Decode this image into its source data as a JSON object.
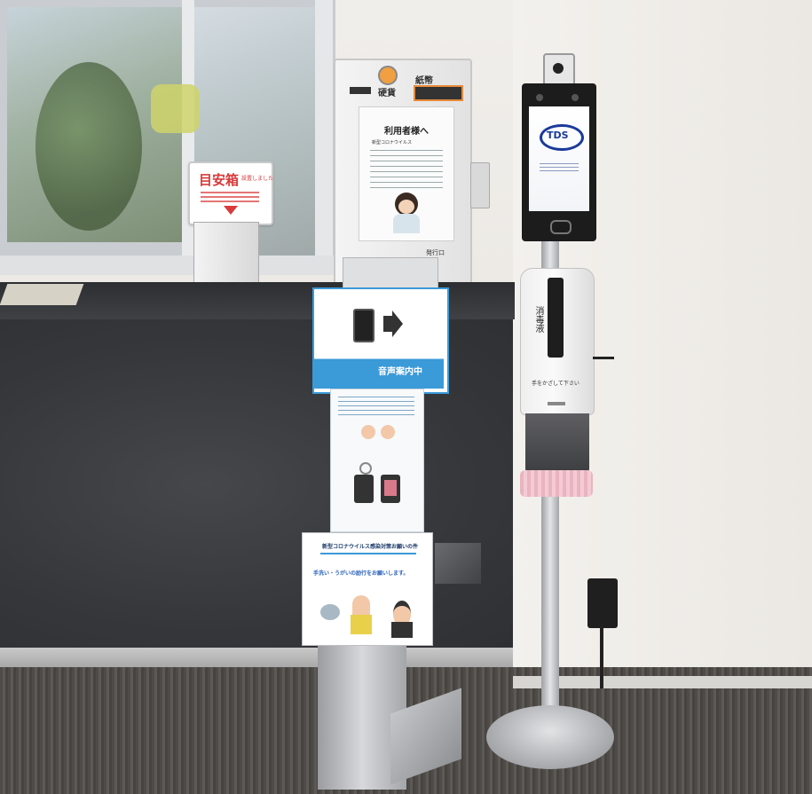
{
  "signs": {
    "red_sign": {
      "headline": "目安箱",
      "suffix": "設置しました"
    },
    "ticket_machine": {
      "coin_label": "硬貨",
      "bill_label": "紙幣",
      "output_label": "発行口"
    },
    "notice": {
      "title": "利用者様へ",
      "highlight": "新型コロナウイルス"
    },
    "thermal_screen": {
      "brand": "TDS"
    },
    "dispenser": {
      "vertical_label": "消毒液",
      "instruction": "手をかざして下さい"
    },
    "stand_top": {
      "status": "音声案内中"
    },
    "stand_bottom": {
      "title": "新型コロナウイルス感染対策お願いの件",
      "message": "手洗い・うがいの励行をお願いします。"
    }
  },
  "colors": {
    "counter": "#3a3b3e",
    "wall": "#ece9e4",
    "sign_red": "#d83a3a",
    "sign_blue": "#3b9ad8",
    "screen_blue": "#1a3a9a"
  }
}
